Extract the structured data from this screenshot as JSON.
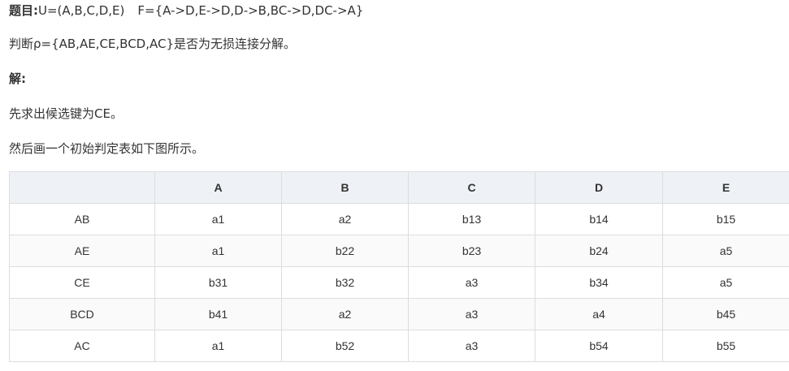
{
  "problem": {
    "label": "题目:",
    "u_text": "U=(A,B,C,D,E)",
    "f_text": "F={A->D,E->D,D->B,BC->D,DC->A}"
  },
  "question": "判断ρ={AB,AE,CE,BCD,AC}是否为无损连接分解。",
  "solution_label": "解:",
  "step1": "先求出候选键为CE。",
  "step2": "然后画一个初始判定表如下图所示。",
  "table": {
    "headers": [
      "",
      "A",
      "B",
      "C",
      "D",
      "E"
    ],
    "rows": [
      [
        "AB",
        "a1",
        "a2",
        "b13",
        "b14",
        "b15"
      ],
      [
        "AE",
        "a1",
        "b22",
        "b23",
        "b24",
        "a5"
      ],
      [
        "CE",
        "b31",
        "b32",
        "a3",
        "b34",
        "a5"
      ],
      [
        "BCD",
        "b41",
        "a2",
        "a3",
        "a4",
        "b45"
      ],
      [
        "AC",
        "a1",
        "b52",
        "a3",
        "b54",
        "b55"
      ]
    ]
  }
}
